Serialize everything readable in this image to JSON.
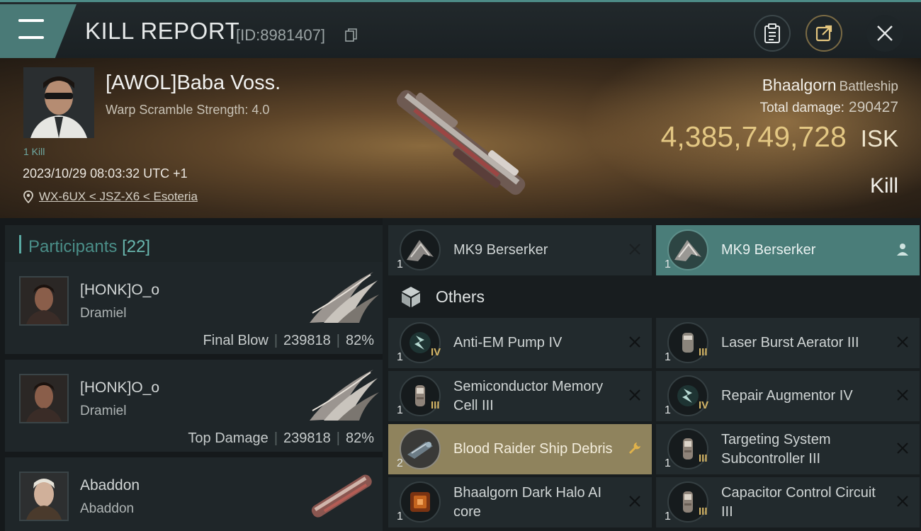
{
  "header": {
    "title": "KILL REPORT",
    "report_id": "[ID:8981407]"
  },
  "victim": {
    "name": "[AWOL]Baba Voss.",
    "warp_scramble": "Warp Scramble Strength: 4.0",
    "kill_count": "1 Kill",
    "datetime": "2023/10/29 08:03:32 UTC +1",
    "location": "WX-6UX < JSZ-X6 < Esoteria",
    "ship_name": "Bhaalgorn",
    "ship_class": "Battleship",
    "damage_label": "Total damage:",
    "damage_value": "290427",
    "isk_value": "4,385,749,728",
    "isk_unit": "ISK",
    "result": "Kill"
  },
  "participants": {
    "label": "Participants",
    "count": "[22]",
    "rows": [
      {
        "name": "[HONK]O_o",
        "ship": "Dramiel",
        "role": "Final Blow",
        "damage": "239818",
        "percent": "82%"
      },
      {
        "name": "[HONK]O_o",
        "ship": "Dramiel",
        "role": "Top Damage",
        "damage": "239818",
        "percent": "82%"
      },
      {
        "name": "Abaddon",
        "ship": "Abaddon"
      }
    ]
  },
  "items": {
    "top": [
      {
        "qty": "1",
        "name": "MK9  Berserker",
        "icon": "drone-icon"
      },
      {
        "qty": "1",
        "name": "MK9  Berserker",
        "icon": "drone-icon"
      }
    ],
    "others_label": "Others",
    "list": [
      {
        "qty": "1",
        "meta": "IV",
        "name": "Anti-EM Pump IV",
        "icon": "rig-icon"
      },
      {
        "qty": "1",
        "meta": "III",
        "name": "Laser Burst Aerator III",
        "icon": "rig-icon"
      },
      {
        "qty": "1",
        "meta": "III",
        "name": "Semiconductor Memory Cell III",
        "icon": "rig-icon"
      },
      {
        "qty": "1",
        "meta": "IV",
        "name": "Repair Augmentor IV",
        "icon": "rig-icon"
      },
      {
        "qty": "2",
        "meta": "",
        "name": "Blood Raider Ship Debris",
        "icon": "salvage-icon"
      },
      {
        "qty": "1",
        "meta": "III",
        "name": "Targeting System Subcontroller III",
        "icon": "rig-icon"
      },
      {
        "qty": "1",
        "meta": "",
        "name": "Bhaalgorn Dark Halo AI core",
        "icon": "ai-core-icon"
      },
      {
        "qty": "1",
        "meta": "III",
        "name": "Capacitor Control Circuit III",
        "icon": "rig-icon"
      }
    ]
  },
  "colors": {
    "accent": "#4a7d79",
    "isk": "#e3c783",
    "dropped": "#8f835d"
  }
}
